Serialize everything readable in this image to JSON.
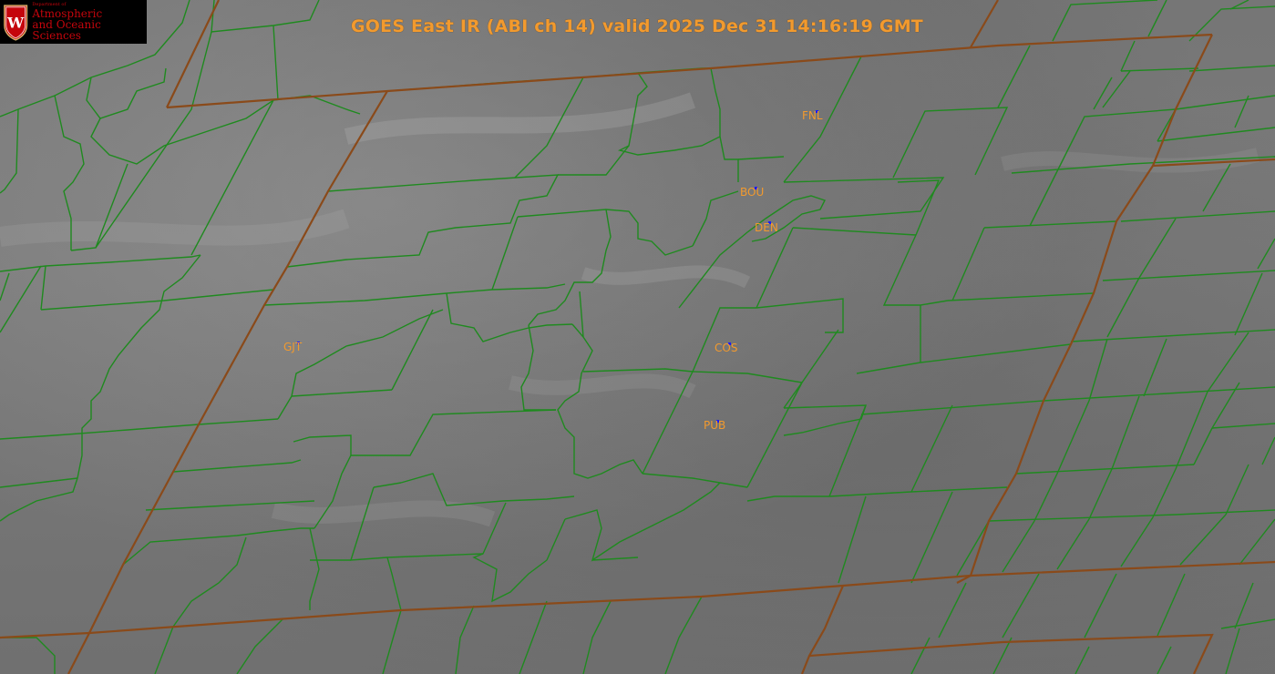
{
  "title": "GOES East IR (ABI ch 14) valid 2025 Dec 31 14:16:19 GMT",
  "logo": {
    "dept": "Department of",
    "line1": "Atmospheric",
    "line2": "and Oceanic Sciences",
    "crest_letter": "W"
  },
  "stations": [
    {
      "code": "FNL"
    },
    {
      "code": "BOU"
    },
    {
      "code": "DEN"
    },
    {
      "code": "GJT"
    },
    {
      "code": "COS"
    },
    {
      "code": "PUB"
    }
  ],
  "colors": {
    "title": "#f29a2e",
    "station_label": "#f29a2e",
    "station_marker": "#1a1aff",
    "county_lines": "#1f8a1f",
    "state_lines": "#8a4a1a",
    "logo_text": "#c5050c",
    "logo_bg": "#000000"
  }
}
